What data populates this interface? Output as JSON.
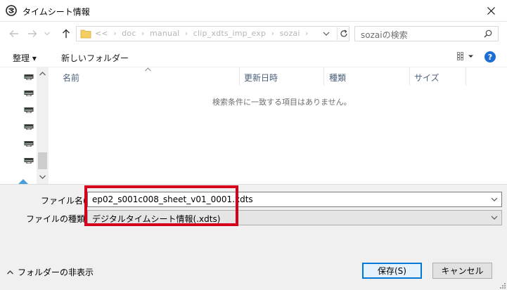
{
  "window": {
    "title": "タイムシート情報"
  },
  "address_bar": {
    "path": [
      "<<",
      "doc",
      "manual",
      "clip_xdts_imp_exp",
      "sozai"
    ]
  },
  "search": {
    "placeholder": "sozaiの検索"
  },
  "toolbar": {
    "organize": "整理 ▾",
    "new_folder": "新しいフォルダー"
  },
  "columns": [
    "名前",
    "更新日時",
    "種類",
    "サイズ"
  ],
  "file_list": {
    "empty_message": "検索条件に一致する項目はありません。"
  },
  "form": {
    "filename_label": "ファイル名(N):",
    "filename_value": "ep02_s001c008_sheet_v01_0001.xdts",
    "filetype_label": "ファイルの種類(T):",
    "filetype_value": "デジタルタイムシート情報(.xdts)"
  },
  "footer": {
    "hide_folders": "フォルダーの非表示",
    "save": "保存(S)",
    "cancel": "キャンセル"
  },
  "colors": {
    "highlight": "#d6001c",
    "primary_border": "#0078d7",
    "help": "#1c6ed2"
  }
}
